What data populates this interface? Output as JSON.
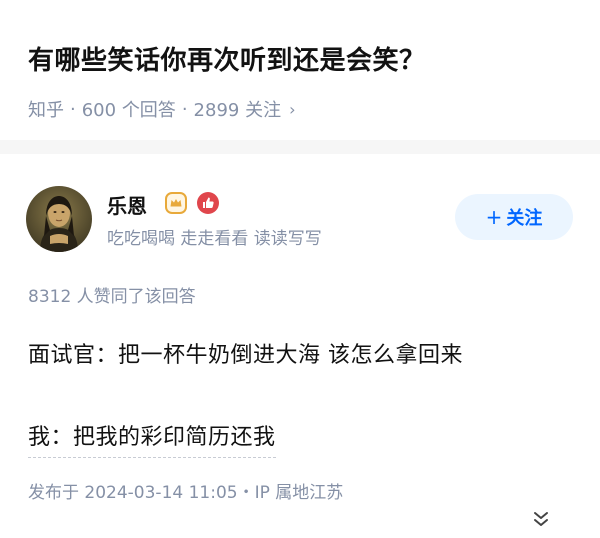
{
  "question": {
    "title": "有哪些笑话你再次听到还是会笑？",
    "source": "知乎",
    "separator": "·",
    "answers_count": "600 个回答",
    "followers_count": "2899 关注",
    "chevron": "›"
  },
  "author": {
    "name": "乐恩",
    "bio": "吃吃喝喝 走走看看 读读写写",
    "badge_icons": [
      "crown-badge-icon",
      "thumbs-up-badge-icon"
    ],
    "follow_label": "关注",
    "follow_plus": "+"
  },
  "answer": {
    "votes": "8312 人赞同了该回答",
    "lines": [
      "面试官：把一杯牛奶倒进大海 该怎么拿回来",
      "我：把我的彩印简历还我"
    ],
    "published": "发布于 2024-03-14 11:05・IP 属地江苏"
  },
  "colors": {
    "brand_blue": "#0066ff",
    "follow_bg": "#ebf5ff",
    "meta_gray": "#8590a6",
    "badge_gold": "#e8a93a",
    "badge_red": "#e0464c"
  }
}
